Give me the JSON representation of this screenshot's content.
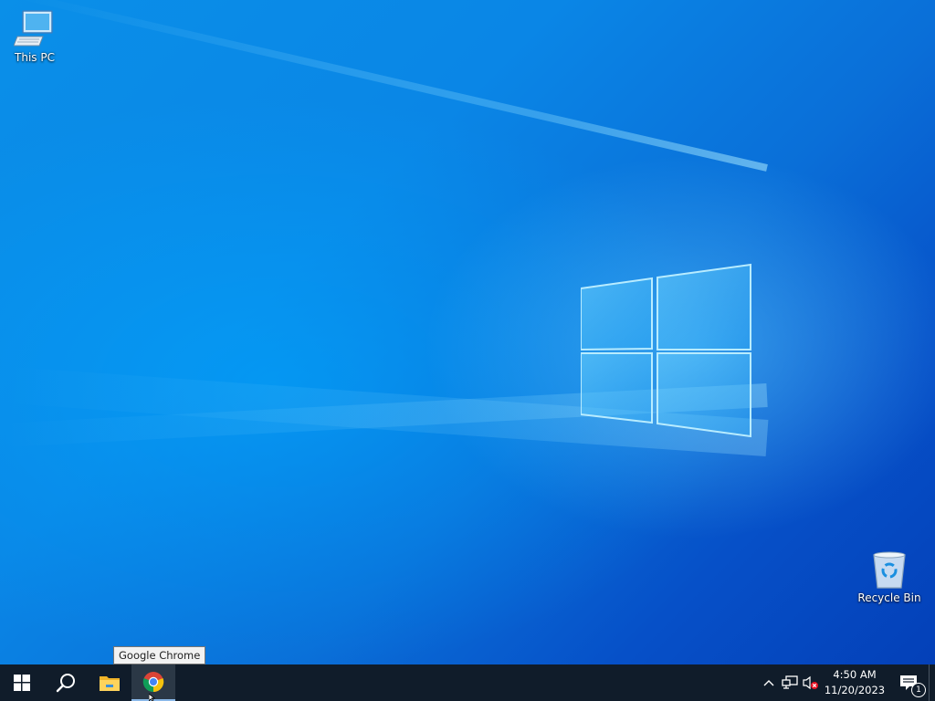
{
  "desktop": {
    "icons": [
      {
        "name": "this-pc",
        "label": "This PC"
      },
      {
        "name": "recycle-bin",
        "label": "Recycle Bin"
      }
    ]
  },
  "tooltip": {
    "text": "Google Chrome"
  },
  "taskbar": {
    "buttons": [
      {
        "name": "start",
        "icon": "windows-logo-icon"
      },
      {
        "name": "search",
        "icon": "search-icon"
      },
      {
        "name": "file-explorer",
        "icon": "folder-icon"
      },
      {
        "name": "google-chrome",
        "icon": "chrome-icon",
        "active": true
      }
    ],
    "tray": {
      "icons": [
        "chevron-up-icon",
        "network-icon",
        "volume-muted-icon"
      ],
      "time": "4:50 AM",
      "date": "11/20/2023",
      "notification_count": "1"
    }
  },
  "colors": {
    "taskbar_bg": "#101c2a",
    "wallpaper_accent": "#0a86e6"
  }
}
